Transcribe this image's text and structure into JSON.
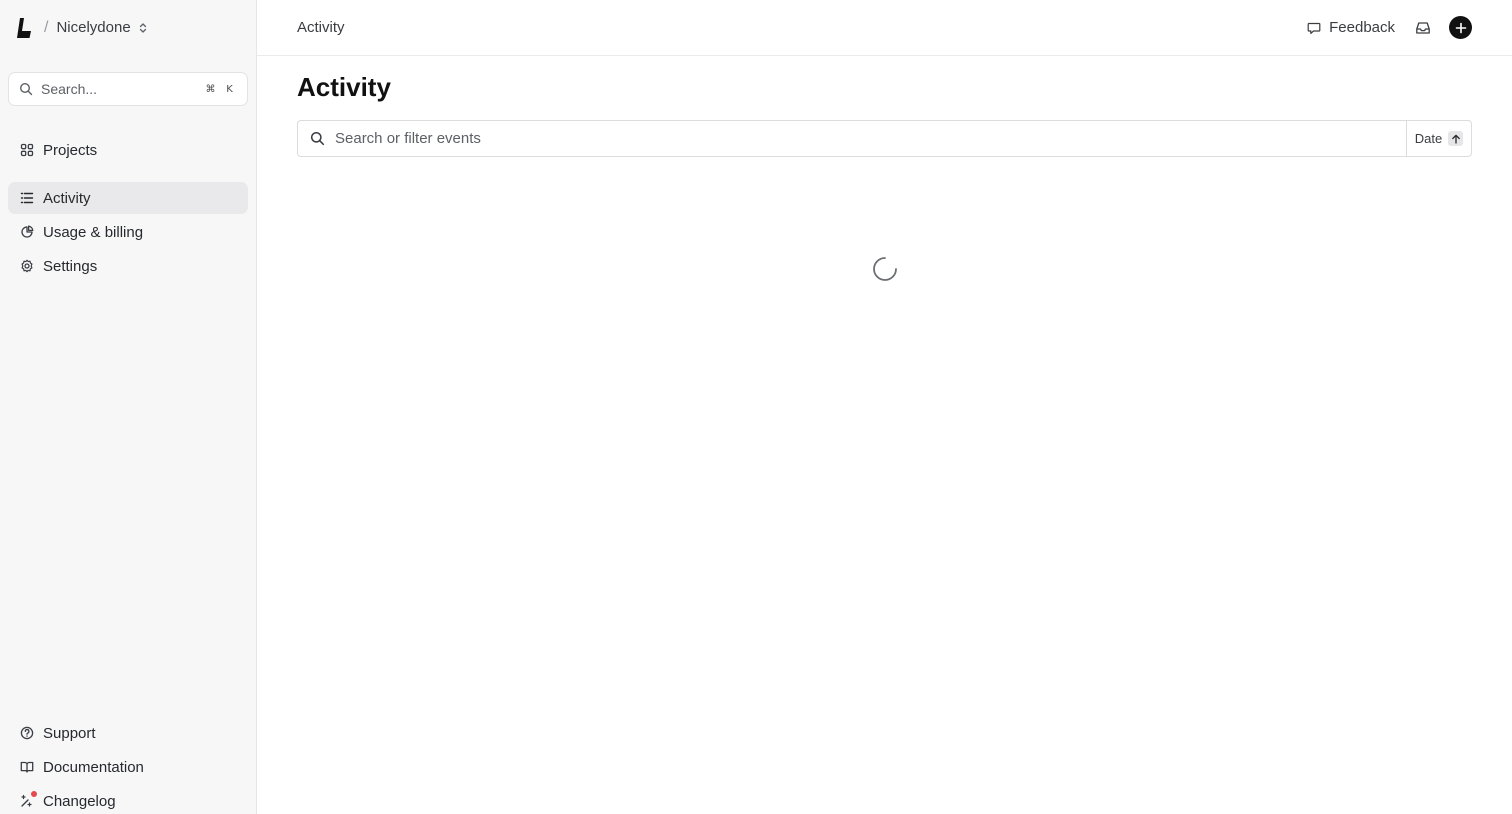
{
  "sidebar": {
    "team_name": "Nicelydone",
    "separator": "/",
    "search": {
      "placeholder": "Search...",
      "shortcut_mod": "⌘",
      "shortcut_key": "K"
    },
    "primary_nav": [
      {
        "label": "Projects",
        "icon": "grid-icon",
        "active": false
      }
    ],
    "secondary_nav": [
      {
        "label": "Activity",
        "icon": "list-icon",
        "active": true
      },
      {
        "label": "Usage & billing",
        "icon": "pie-chart-icon",
        "active": false
      },
      {
        "label": "Settings",
        "icon": "gear-icon",
        "active": false
      }
    ],
    "footer_nav": [
      {
        "label": "Support",
        "icon": "help-circle-icon"
      },
      {
        "label": "Documentation",
        "icon": "book-icon"
      },
      {
        "label": "Changelog",
        "icon": "sparkle-icon",
        "has_notification_dot": true
      }
    ]
  },
  "topbar": {
    "breadcrumb": "Activity",
    "feedback_label": "Feedback"
  },
  "main": {
    "title": "Activity",
    "filter": {
      "placeholder": "Search or filter events",
      "sort_label": "Date",
      "sort_direction": "ascending"
    },
    "loading": true
  },
  "colors": {
    "sidebar_bg": "#f7f7f8",
    "active_item_bg": "#e9e9eb",
    "notification_dot": "#e5484d",
    "primary_button": "#111111"
  }
}
